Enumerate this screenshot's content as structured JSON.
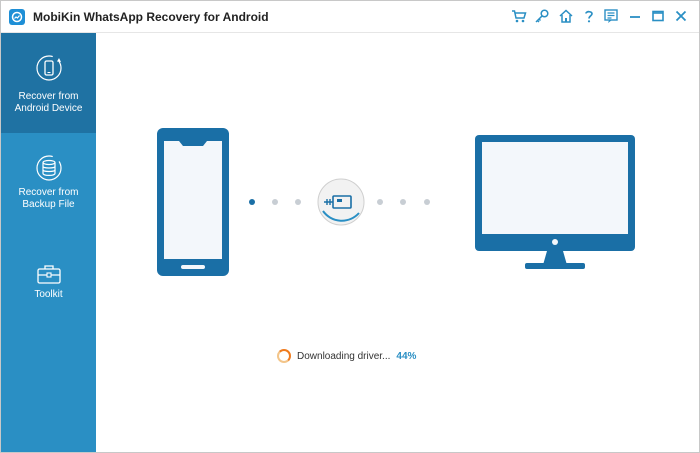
{
  "app": {
    "title": "MobiKin WhatsApp Recovery for Android"
  },
  "titlebar": {
    "icons": [
      "cart-icon",
      "key-icon",
      "home-icon",
      "help-icon",
      "feedback-icon",
      "minimize-icon",
      "maximize-icon",
      "close-icon"
    ]
  },
  "sidebar": {
    "items": [
      {
        "label": "Recover from Android Device",
        "line1": "Recover from",
        "line2": "Android Device",
        "icon": "phone-refresh-icon",
        "active": true
      },
      {
        "label": "Recover from Backup File",
        "line1": "Recover from",
        "line2": "Backup File",
        "icon": "database-icon",
        "active": false
      },
      {
        "label": "Toolkit",
        "line1": "Toolkit",
        "line2": "",
        "icon": "toolbox-icon",
        "active": false
      }
    ]
  },
  "connection": {
    "left_device": "phone-icon",
    "right_device": "monitor-icon",
    "connector": "usb-icon"
  },
  "status": {
    "text": "Downloading driver...",
    "percent": "44%",
    "progress": 0.44
  },
  "colors": {
    "accent": "#2a8fc4",
    "sidebar_active": "#1f72a3",
    "device_blue": "#1a6fa6",
    "spinner": "#f07b1d"
  }
}
